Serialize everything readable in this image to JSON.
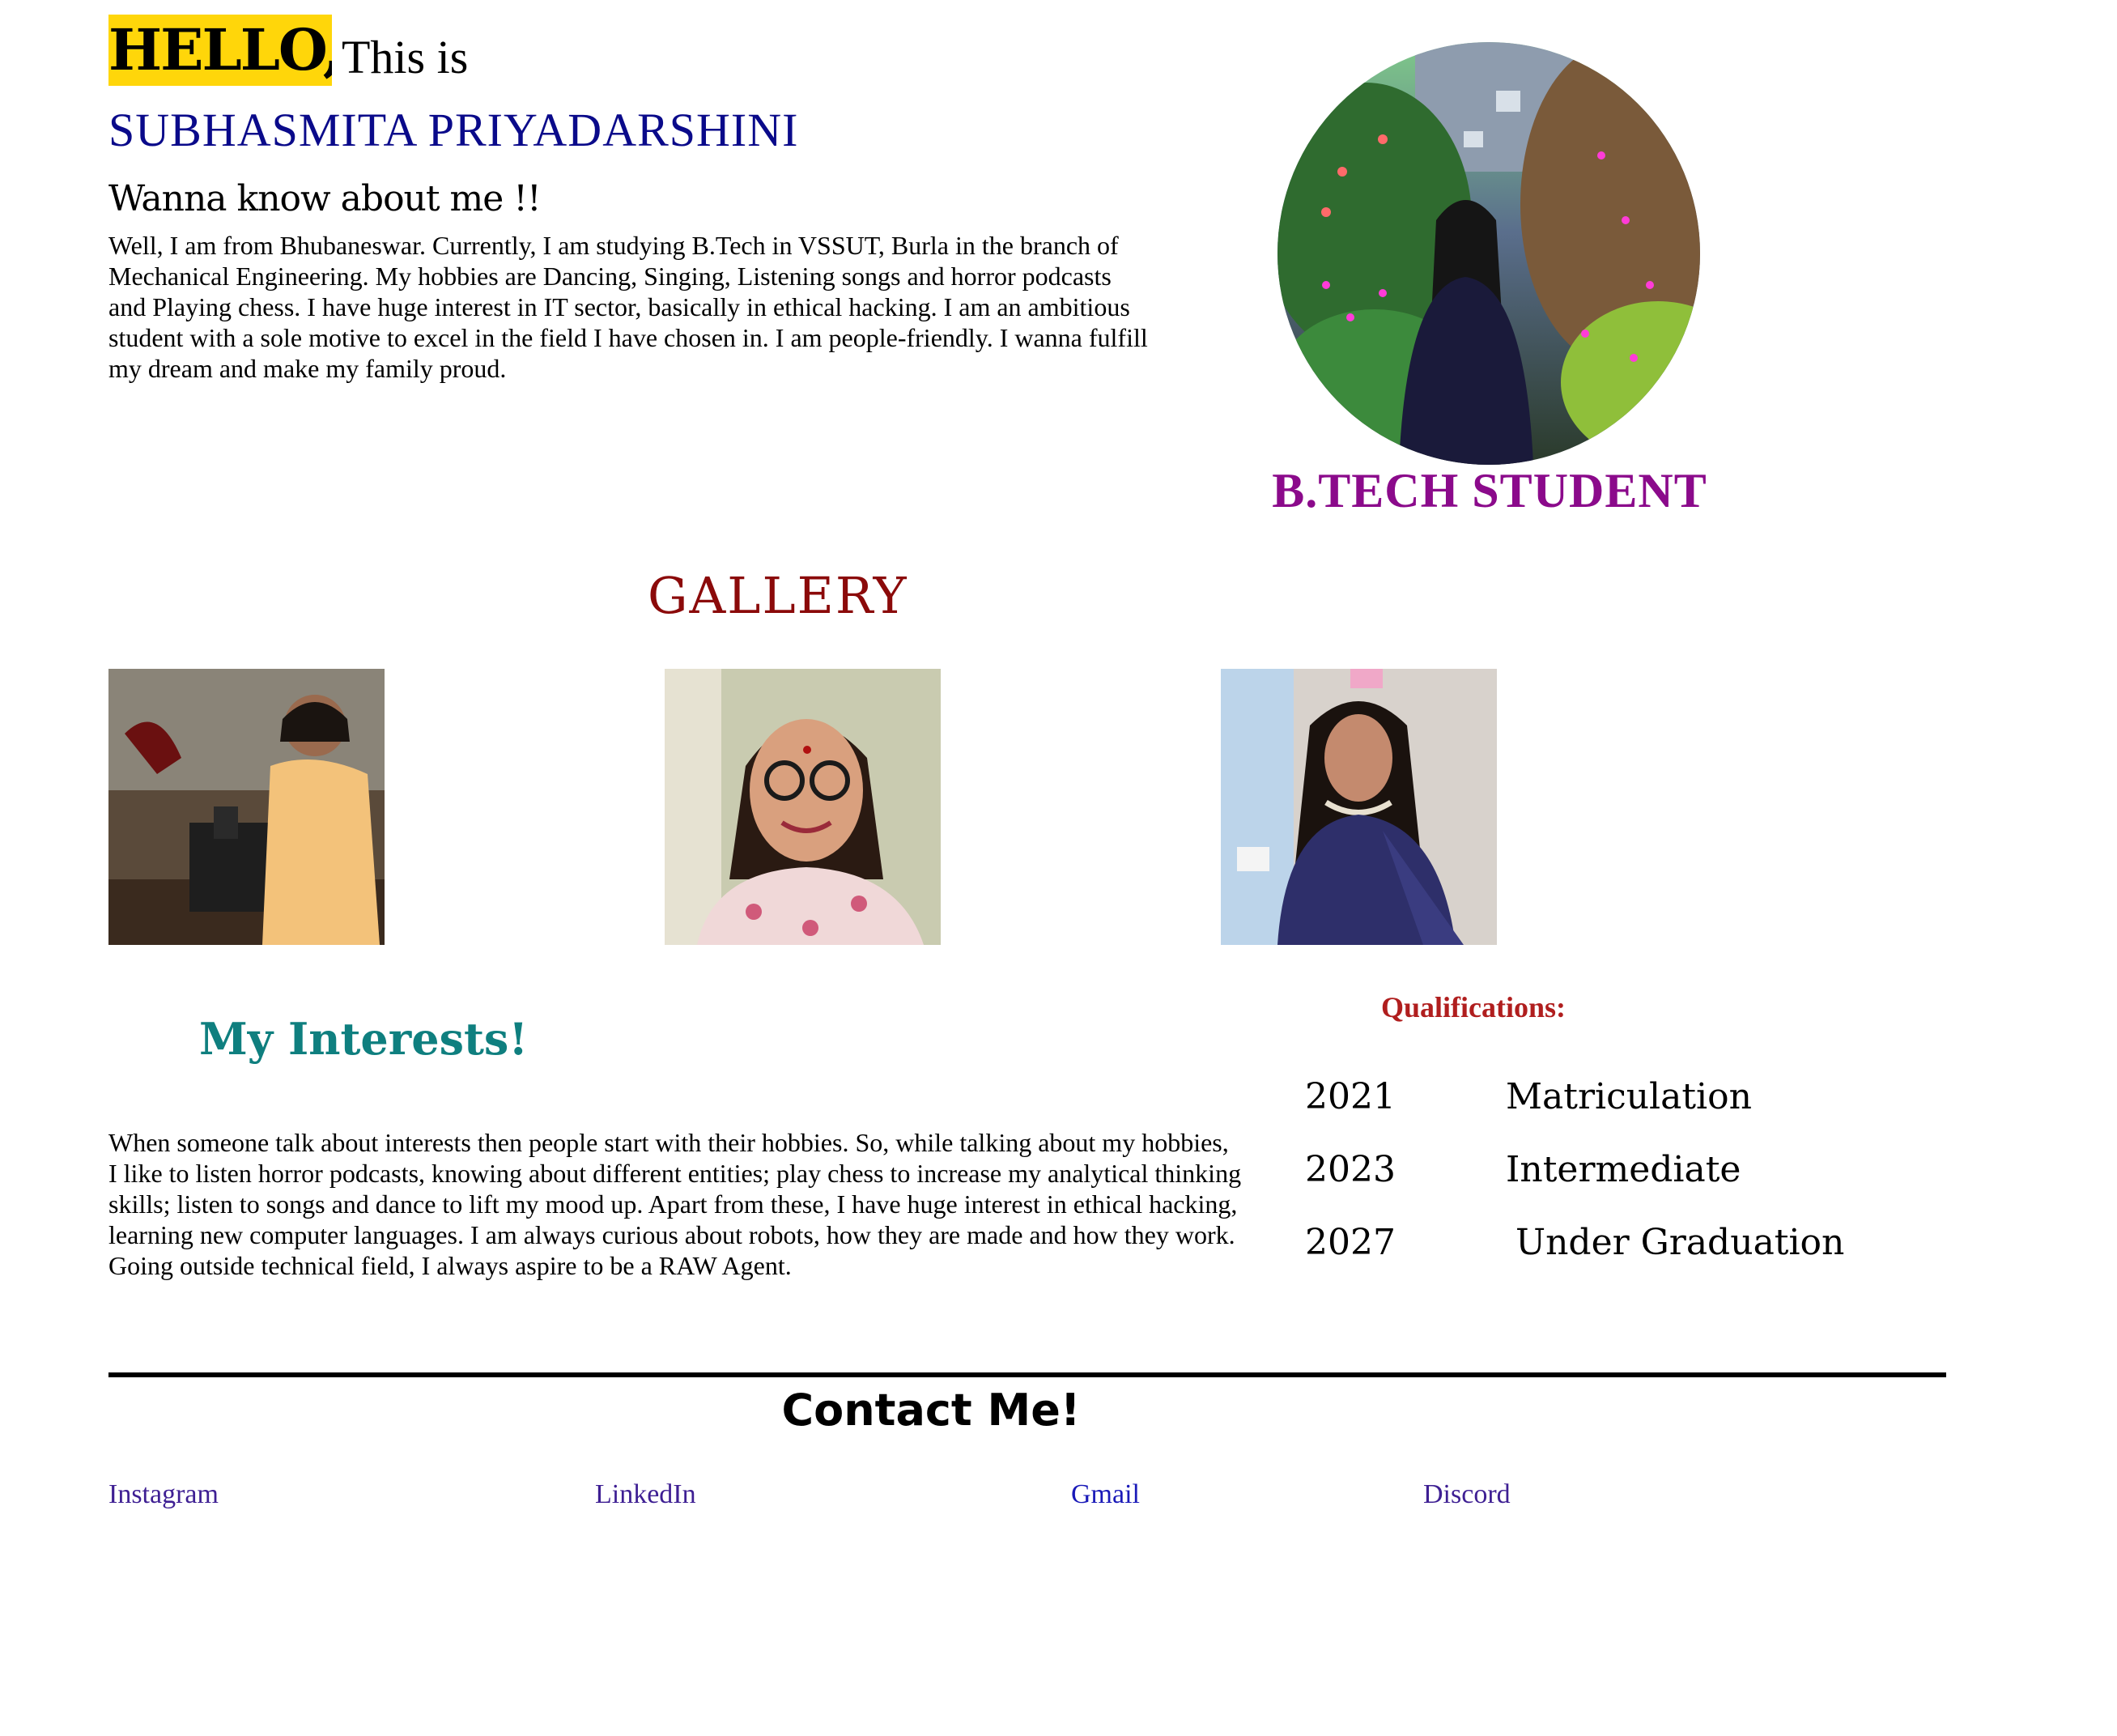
{
  "hero": {
    "hello": "HELLO,",
    "this_is": "This is",
    "name": "SUBHASMITA PRIYADARSHINI",
    "about_heading": "Wanna know about me !!",
    "about_text": "Well, I am from Bhubaneswar. Currently, I am studying B.Tech in VSSUT, Burla in the branch of Mechanical Engineering. My hobbies are Dancing, Singing, Listening songs and horror podcasts and Playing chess. I have huge interest in IT sector, basically in ethical hacking. I am an ambitious student with a sole motive to excel in the field I have chosen in. I am people-friendly. I wanna fulfill my dream and make my family proud.",
    "role": "B.TECH STUDENT"
  },
  "gallery": {
    "title": "GALLERY"
  },
  "interests": {
    "title": "My Interests!",
    "text": "When someone talk about interests then people start with their hobbies. So, while talking about my hobbies, I like to listen horror podcasts, knowing about different entities; play chess to increase my analytical thinking skills; listen to songs and dance to lift my mood up. Apart from these, I have huge interest in ethical hacking, learning new computer languages. I am always curious about robots, how they are made and how they work. Going outside technical field, I always aspire to be a RAW Agent."
  },
  "qualifications": {
    "title": "Qualifications:",
    "rows": [
      {
        "year": "2021",
        "level": "Matriculation"
      },
      {
        "year": "2023",
        "level": "Intermediate"
      },
      {
        "year": "2027",
        "level": "Under Graduation"
      }
    ]
  },
  "contact": {
    "title": "Contact Me!",
    "links": [
      {
        "label": "Instagram"
      },
      {
        "label": "LinkedIn"
      },
      {
        "label": "Gmail"
      },
      {
        "label": "Discord"
      }
    ]
  },
  "colors": {
    "hello_bg": "#ffd60a",
    "name": "#0a0a8a",
    "role": "#8b0a8b",
    "gallery": "#8b0a0a",
    "interests": "#0f7f7f",
    "qualifications": "#b01e1e",
    "link": "#3e1f93",
    "link_gmail": "#1a1ab8"
  }
}
